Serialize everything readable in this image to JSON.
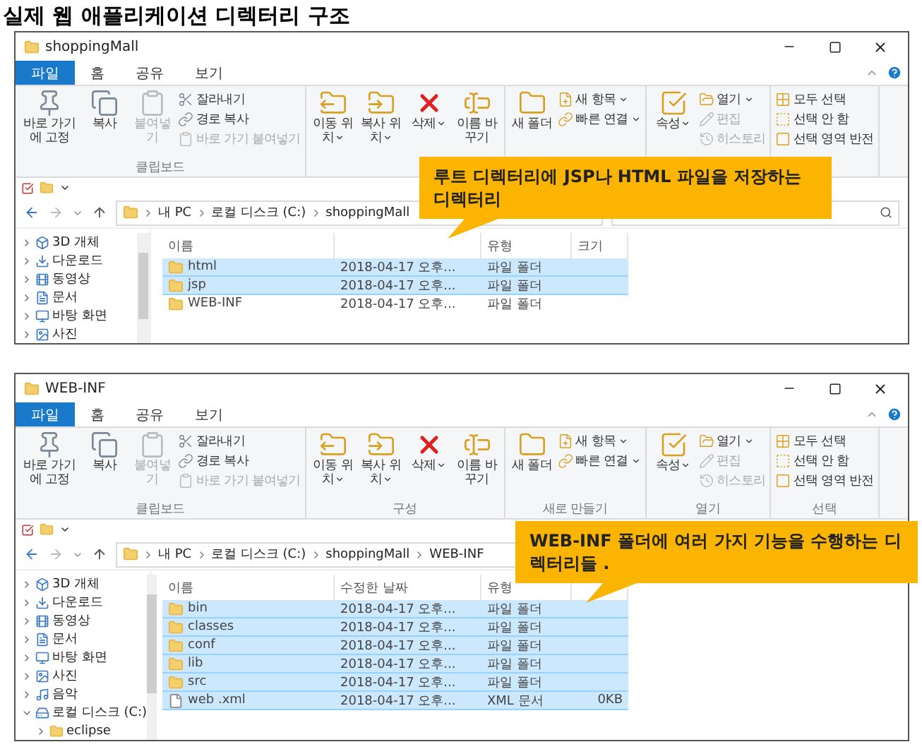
{
  "heading": "실제 웹 애플리케이션 디렉터리 구조",
  "windows": [
    {
      "title": "shoppingMall",
      "tabs": [
        {
          "label": "파일",
          "selected": true
        },
        {
          "label": "홈",
          "selected": false
        },
        {
          "label": "공유",
          "selected": false
        },
        {
          "label": "보기",
          "selected": false
        }
      ],
      "ribbon": [
        {
          "items": [
            {
              "kind": "large",
              "label": "바로 가기에 고정",
              "disabled": false,
              "dropdown": false
            },
            {
              "kind": "large",
              "label": "복사",
              "disabled": false,
              "dropdown": false
            },
            {
              "kind": "large",
              "label": "붙여넣기",
              "disabled": true,
              "dropdown": false
            },
            {
              "kind": "small",
              "label": "잘라내기",
              "disabled": false,
              "dropdown": false
            },
            {
              "kind": "small",
              "label": "경로 복사",
              "disabled": false,
              "dropdown": false
            },
            {
              "kind": "small",
              "label": "바로 가기 붙여넣기",
              "disabled": true,
              "dropdown": false
            }
          ],
          "label": "클립보드"
        },
        {
          "items": [
            {
              "kind": "large",
              "label": "이동 위치",
              "disabled": false,
              "dropdown": true
            },
            {
              "kind": "large",
              "label": "복사 위치",
              "disabled": false,
              "dropdown": true
            },
            {
              "kind": "large",
              "label": "삭제",
              "disabled": false,
              "dropdown": true
            },
            {
              "kind": "large",
              "label": "이름 바꾸기",
              "disabled": false,
              "dropdown": false
            }
          ]
        },
        {
          "items": [
            {
              "kind": "large",
              "label": "새 폴더",
              "disabled": false,
              "dropdown": false
            },
            {
              "kind": "small",
              "label": "새 항목",
              "disabled": false,
              "dropdown": true
            },
            {
              "kind": "small",
              "label": "빠른 연결",
              "disabled": false,
              "dropdown": true
            }
          ]
        },
        {
          "items": [
            {
              "kind": "large",
              "label": "속성",
              "disabled": false,
              "dropdown": true
            },
            {
              "kind": "small",
              "label": "열기",
              "disabled": false,
              "dropdown": true
            },
            {
              "kind": "small",
              "label": "편집",
              "disabled": true,
              "dropdown": false
            },
            {
              "kind": "small",
              "label": "히스토리",
              "disabled": true,
              "dropdown": false
            }
          ]
        },
        {
          "items": [
            {
              "kind": "small",
              "label": "모두 선택",
              "disabled": false,
              "dropdown": false
            },
            {
              "kind": "small",
              "label": "선택 안 함",
              "disabled": false,
              "dropdown": false
            },
            {
              "kind": "small",
              "label": "선택 영역 반전",
              "disabled": false,
              "dropdown": false
            }
          ]
        }
      ],
      "path": [
        "내 PC",
        "로컬 디스크 (C:)",
        "shoppingMall"
      ],
      "nav": [
        {
          "label": "3D 개체",
          "expanded": false
        },
        {
          "label": "다운로드",
          "expanded": false
        },
        {
          "label": "동영상",
          "expanded": false
        },
        {
          "label": "문서",
          "expanded": false
        },
        {
          "label": "바탕 화면",
          "expanded": false
        },
        {
          "label": "사진",
          "expanded": false
        }
      ],
      "columns": [
        {
          "label": "이름"
        },
        {},
        {
          "label": "유형"
        },
        {
          "label": "크기"
        }
      ],
      "rows": [
        {
          "kind": "folder",
          "name": "html",
          "date": "2018-04-17 오후...",
          "type": "파일 폴더",
          "selected": true
        },
        {
          "kind": "folder",
          "name": "jsp",
          "date": "2018-04-17 오후...",
          "type": "파일 폴더",
          "selected": true
        },
        {
          "kind": "folder",
          "name": "WEB-INF",
          "date": "2018-04-17 오후...",
          "type": "파일 폴더",
          "selected": false
        }
      ],
      "callout": "루트 디렉터리에 JSP나 HTML 파일을 저장하는 디렉터리"
    },
    {
      "title": "WEB-INF",
      "tabs": [
        {
          "label": "파일",
          "selected": true
        },
        {
          "label": "홈",
          "selected": false
        },
        {
          "label": "공유",
          "selected": false
        },
        {
          "label": "보기",
          "selected": false
        }
      ],
      "ribbon": [
        {
          "items": [
            {
              "kind": "large",
              "label": "바로 가기에 고정",
              "disabled": false,
              "dropdown": false
            },
            {
              "kind": "large",
              "label": "복사",
              "disabled": false,
              "dropdown": false
            },
            {
              "kind": "large",
              "label": "붙여넣기",
              "disabled": true,
              "dropdown": false
            },
            {
              "kind": "small",
              "label": "잘라내기",
              "disabled": false,
              "dropdown": false
            },
            {
              "kind": "small",
              "label": "경로 복사",
              "disabled": false,
              "dropdown": false
            },
            {
              "kind": "small",
              "label": "바로 가기 붙여넣기",
              "disabled": true,
              "dropdown": false
            }
          ],
          "label": "클립보드"
        },
        {
          "items": [
            {
              "kind": "large",
              "label": "이동 위치",
              "disabled": false,
              "dropdown": true
            },
            {
              "kind": "large",
              "label": "복사 위치",
              "disabled": false,
              "dropdown": true
            },
            {
              "kind": "large",
              "label": "삭제",
              "disabled": false,
              "dropdown": true
            },
            {
              "kind": "large",
              "label": "이름 바꾸기",
              "disabled": false,
              "dropdown": false
            }
          ],
          "label": "구성"
        },
        {
          "items": [
            {
              "kind": "large",
              "label": "새 폴더",
              "disabled": false,
              "dropdown": false
            },
            {
              "kind": "small",
              "label": "새 항목",
              "disabled": false,
              "dropdown": true
            },
            {
              "kind": "small",
              "label": "빠른 연결",
              "disabled": false,
              "dropdown": true
            }
          ],
          "label": "새로 만들기"
        },
        {
          "items": [
            {
              "kind": "large",
              "label": "속성",
              "disabled": false,
              "dropdown": true
            },
            {
              "kind": "small",
              "label": "열기",
              "disabled": false,
              "dropdown": true
            },
            {
              "kind": "small",
              "label": "편집",
              "disabled": true,
              "dropdown": false
            },
            {
              "kind": "small",
              "label": "히스토리",
              "disabled": true,
              "dropdown": false
            }
          ],
          "label": "열기"
        },
        {
          "items": [
            {
              "kind": "small",
              "label": "모두 선택",
              "disabled": false,
              "dropdown": false
            },
            {
              "kind": "small",
              "label": "선택 안 함",
              "disabled": false,
              "dropdown": false
            },
            {
              "kind": "small",
              "label": "선택 영역 반전",
              "disabled": false,
              "dropdown": false
            }
          ],
          "label": "선택"
        }
      ],
      "path": [
        "내 PC",
        "로컬 디스크 (C:)",
        "shoppingMall",
        "WEB-INF"
      ],
      "nav": [
        {
          "label": "3D 개체",
          "expanded": false
        },
        {
          "label": "다운로드",
          "expanded": false
        },
        {
          "label": "동영상",
          "expanded": false
        },
        {
          "label": "문서",
          "expanded": false
        },
        {
          "label": "바탕 화면",
          "expanded": false
        },
        {
          "label": "사진",
          "expanded": false
        },
        {
          "label": "음악",
          "expanded": false
        },
        {
          "label": "로컬 디스크 (C:)",
          "expanded": true,
          "children": [
            {
              "label": "eclipse",
              "expanded": false
            }
          ]
        }
      ],
      "columns": [
        {
          "label": "이름"
        },
        {
          "label": "수정한 날짜"
        },
        {
          "label": "유형"
        },
        {}
      ],
      "rows": [
        {
          "kind": "folder",
          "name": "bin",
          "date": "2018-04-17 오후...",
          "type": "파일 폴더",
          "selected": true
        },
        {
          "kind": "folder",
          "name": "classes",
          "date": "2018-04-17 오후...",
          "type": "파일 폴더",
          "selected": true
        },
        {
          "kind": "folder",
          "name": "conf",
          "date": "2018-04-17 오후...",
          "type": "파일 폴더",
          "selected": true
        },
        {
          "kind": "folder",
          "name": "lib",
          "date": "2018-04-17 오후...",
          "type": "파일 폴더",
          "selected": true
        },
        {
          "kind": "folder",
          "name": "src",
          "date": "2018-04-17 오후...",
          "type": "파일 폴더",
          "selected": true
        },
        {
          "kind": "file",
          "name": "web .xml",
          "date": "2018-04-17 오후...",
          "type": "XML 문서",
          "size": "0KB",
          "selected": true
        }
      ],
      "callout": "WEB-INF 폴더에 여러 가지 기능을 수행하는 디렉터리들 ."
    }
  ]
}
